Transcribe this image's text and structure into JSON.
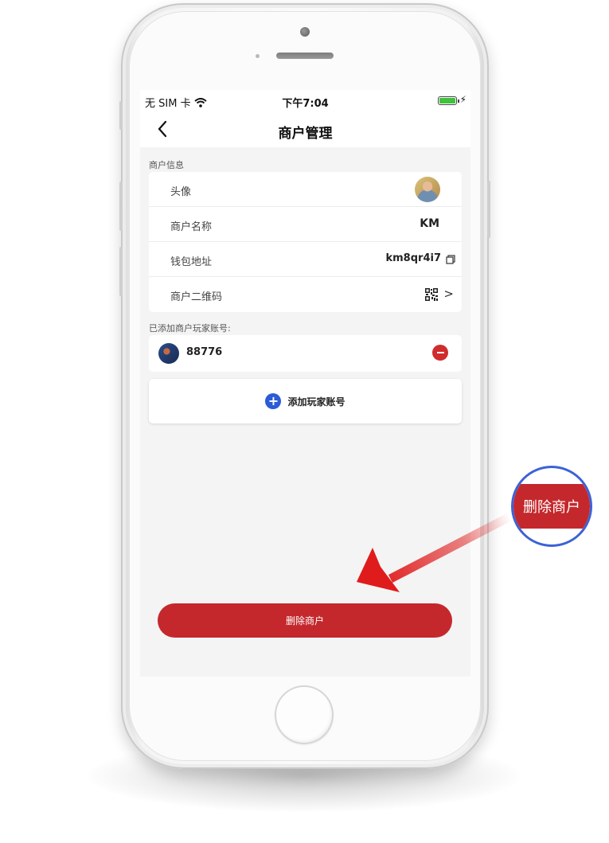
{
  "status_bar": {
    "carrier": "无 SIM 卡",
    "time": "下午7:04"
  },
  "nav": {
    "title": "商户管理"
  },
  "merchant_info": {
    "section_title": "商户信息",
    "rows": [
      {
        "label": "头像"
      },
      {
        "label": "商户名称",
        "value": "KM"
      },
      {
        "label": "钱包地址",
        "value": "km8qr4i7"
      },
      {
        "label": "商户二维码",
        "value": ">"
      }
    ]
  },
  "players": {
    "section_title": "已添加商户玩家账号:",
    "items": [
      {
        "id": "88776"
      }
    ],
    "add_label": "添加玩家账号"
  },
  "actions": {
    "delete_label": "删除商户"
  },
  "callout": {
    "label": "删除商户"
  },
  "colors": {
    "danger": "#c4282c",
    "accent_blue": "#2c5bd6",
    "callout_ring": "#3c62d6"
  }
}
